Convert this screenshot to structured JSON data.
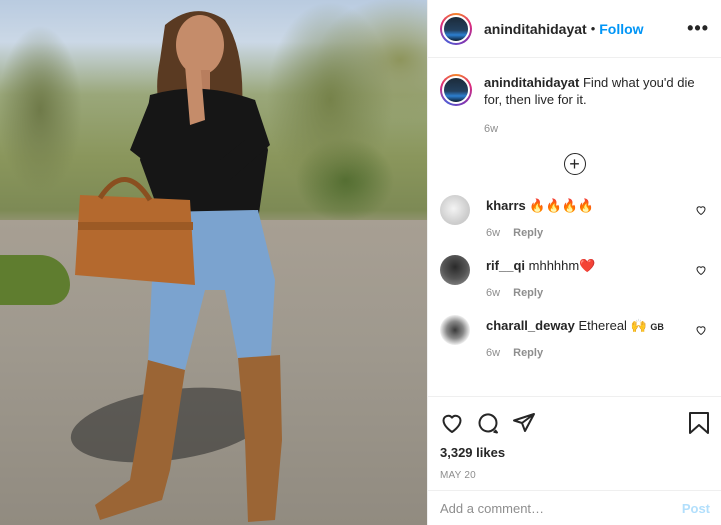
{
  "post": {
    "author": "aninditahidayat",
    "separator": "•",
    "follow_label": "Follow",
    "more_icon": "more-horizontal-icon"
  },
  "caption": {
    "username": "aninditahidayat",
    "text": "Find what you'd die for, then live for it.",
    "age": "6w"
  },
  "load_more_icon": "plus-circle-icon",
  "comments": [
    {
      "username": "kharrs",
      "text": "🔥🔥🔥🔥",
      "age": "6w",
      "reply_label": "Reply",
      "avatar_color": "#d9d9d9"
    },
    {
      "username": "rif__qi",
      "text": "mhhhhm❤️",
      "age": "6w",
      "reply_label": "Reply",
      "avatar_color": "#6e6e6e"
    },
    {
      "username": "charall_deway",
      "text": "Ethereal 🙌",
      "extra": "GB",
      "age": "6w",
      "reply_label": "Reply",
      "avatar_color": "#e8e8e8"
    }
  ],
  "actions": {
    "like_icon": "heart-icon",
    "comment_icon": "comment-icon",
    "share_icon": "paper-plane-icon",
    "save_icon": "bookmark-icon"
  },
  "likes": "3,329 likes",
  "date": "MAY 20",
  "add_comment": {
    "placeholder": "Add a comment…",
    "post_label": "Post"
  },
  "colors": {
    "accent": "#0095f6",
    "post_disabled": "#b2dffc",
    "muted": "#8e8e8e"
  }
}
